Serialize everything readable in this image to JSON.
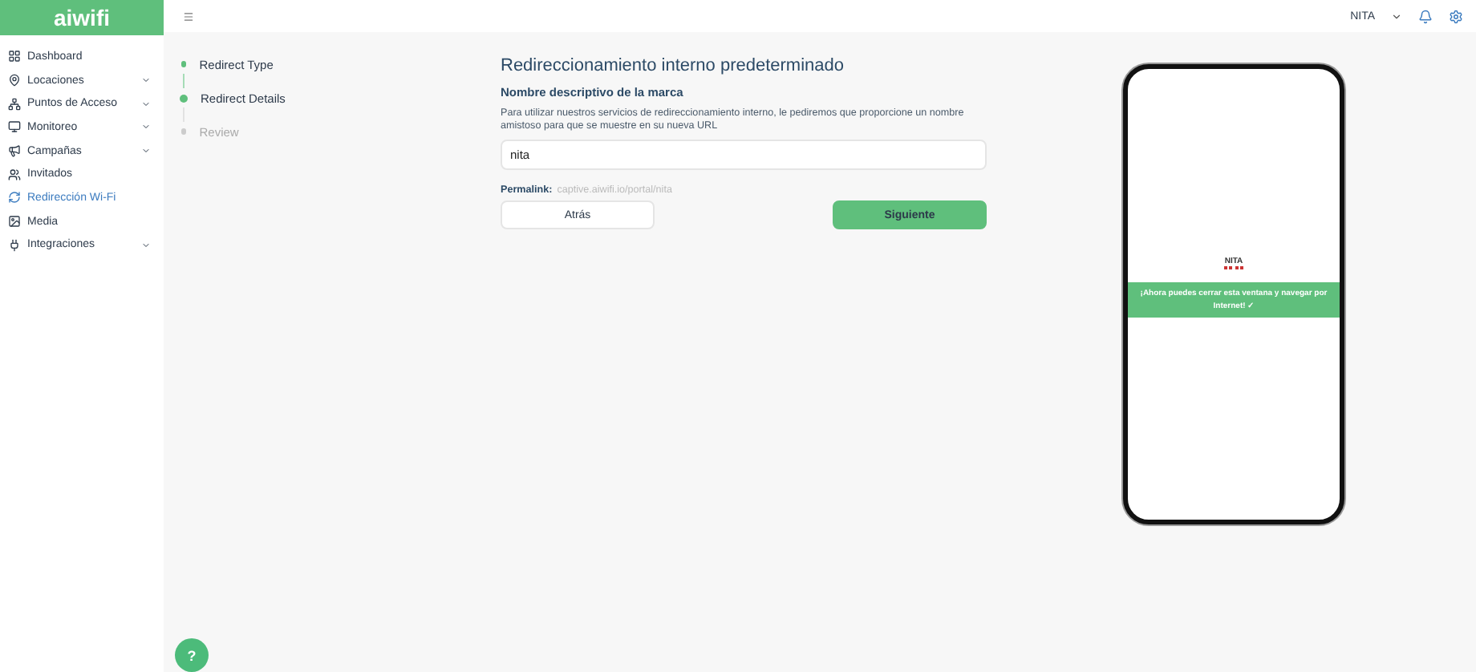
{
  "brand": {
    "logo_text": "aiwifi"
  },
  "sidebar": {
    "items": [
      {
        "label": "Dashboard",
        "has_children": false,
        "selected": false
      },
      {
        "label": "Locaciones",
        "has_children": true,
        "selected": false
      },
      {
        "label": "Puntos de Acceso",
        "has_children": true,
        "selected": false
      },
      {
        "label": "Monitoreo",
        "has_children": true,
        "selected": false
      },
      {
        "label": "Campañas",
        "has_children": true,
        "selected": false
      },
      {
        "label": "Invitados",
        "has_children": false,
        "selected": false
      },
      {
        "label": "Redirección Wi-Fi",
        "has_children": false,
        "selected": true
      },
      {
        "label": "Media",
        "has_children": false,
        "selected": false
      },
      {
        "label": "Integraciones",
        "has_children": true,
        "selected": false
      }
    ]
  },
  "topbar": {
    "user": "NITA"
  },
  "steps": [
    {
      "label": "Redirect Type",
      "completed": true,
      "selected": false
    },
    {
      "label": "Redirect Details",
      "completed": false,
      "selected": true
    },
    {
      "label": "Review",
      "completed": false,
      "selected": false
    }
  ],
  "form": {
    "title": "Redireccionamiento interno predeterminado",
    "field_label": "Nombre descriptivo de la marca",
    "help": "Para utilizar nuestros servicios de redireccionamiento interno, le pediremos que proporcione un nombre amistoso para que se muestre en su nueva URL",
    "value": "nita",
    "permalink_label": "Permalink:",
    "permalink": "captive.aiwifi.io/portal/nita",
    "back": "Atrás",
    "next": "Siguiente"
  },
  "preview": {
    "brand": "NITA",
    "message": "¡Ahora puedes cerrar esta ventana y navegar por Internet! ✓"
  },
  "help_button": "?"
}
